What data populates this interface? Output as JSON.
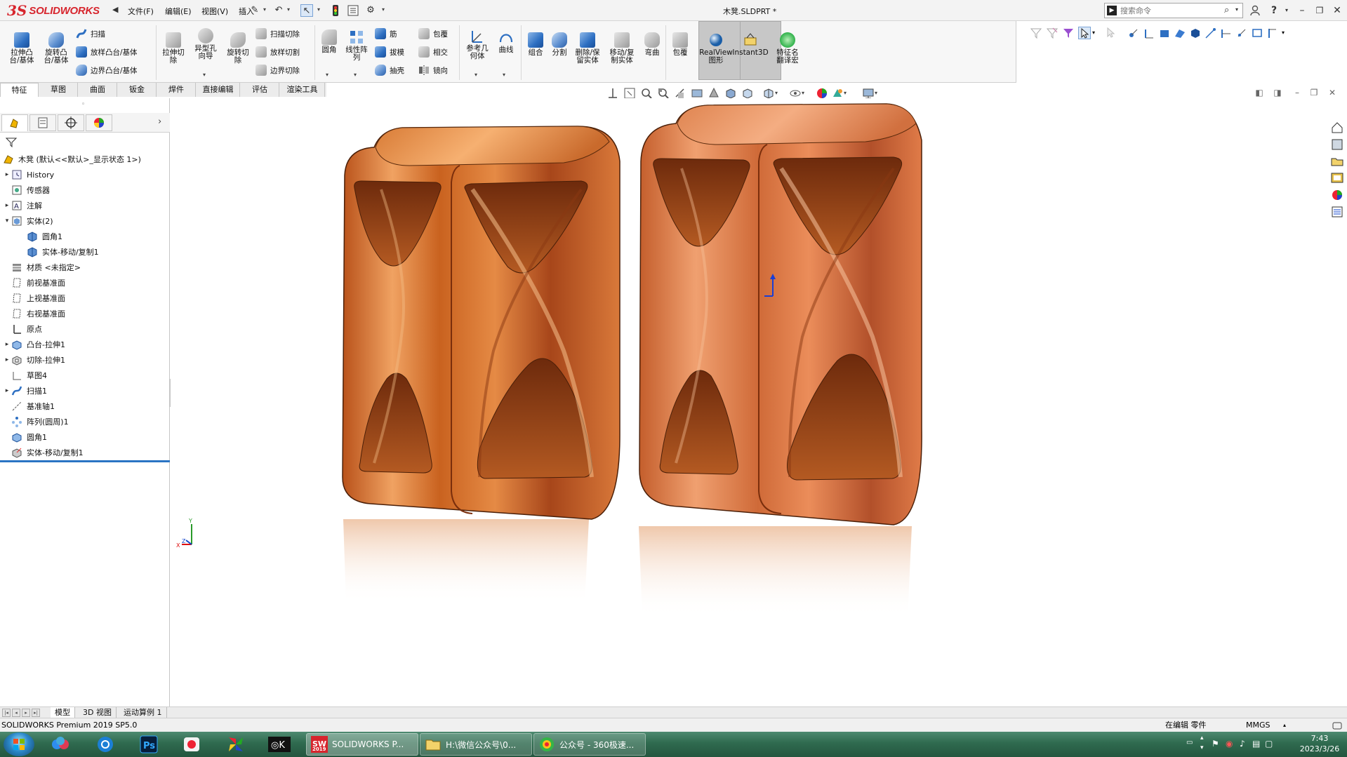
{
  "app": {
    "brand_ds": "3S",
    "brand_name": "SOLIDWORKS",
    "document_title": "木凳.SLDPRT *",
    "menus": [
      "文件(F)",
      "编辑(E)",
      "视图(V)",
      "插入"
    ],
    "search_placeholder": "搜索命令"
  },
  "ribbon": {
    "big_buttons": [
      {
        "name": "extruded-boss-button",
        "label": "拉伸凸\n台/基体"
      },
      {
        "name": "revolved-boss-button",
        "label": "旋转凸\n台/基体"
      },
      {
        "name": "extruded-cut-button",
        "label": "拉伸切\n除"
      },
      {
        "name": "hole-wizard-button",
        "label": "异型孔\n向导"
      },
      {
        "name": "revolved-cut-button",
        "label": "旋转切\n除"
      },
      {
        "name": "fillet-button",
        "label": "圆角"
      },
      {
        "name": "linear-pattern-button",
        "label": "线性阵\n列"
      },
      {
        "name": "reference-geometry-button",
        "label": "参考几\n何体"
      },
      {
        "name": "curves-button",
        "label": "曲线"
      },
      {
        "name": "combine-button",
        "label": "组合"
      },
      {
        "name": "split-button",
        "label": "分割"
      },
      {
        "name": "delete-keep-body-button",
        "label": "删除/保\n留实体"
      },
      {
        "name": "move-copy-body-button",
        "label": "移动/复\n制实体"
      },
      {
        "name": "flex-button",
        "label": "弯曲"
      },
      {
        "name": "wrap-big-button",
        "label": "包覆"
      },
      {
        "name": "realview-button",
        "label": "RealView\n图形"
      },
      {
        "name": "instant3d-button",
        "label": "Instant3D"
      },
      {
        "name": "feature-translate-button",
        "label": "特征名\n翻译宏"
      }
    ],
    "small_buttons": {
      "sweep": "扫描",
      "loft_boss": "放样凸台/基体",
      "boundary_boss": "边界凸台/基体",
      "swept_cut": "扫描切除",
      "lofted_cut": "放样切割",
      "boundary_cut": "边界切除",
      "rib": "筋",
      "draft": "拔模",
      "shell": "抽壳",
      "wrap": "包覆",
      "intersect": "相交",
      "mirror": "镜向"
    }
  },
  "command_tabs": [
    "特征",
    "草图",
    "曲面",
    "钣金",
    "焊件",
    "直接编辑",
    "评估",
    "渲染工具"
  ],
  "feature_tree": [
    {
      "label": "木凳 (默认<<默认>_显示状态 1>)",
      "icon": "part-icon",
      "indent": 0,
      "expander": ""
    },
    {
      "label": "History",
      "icon": "history-icon",
      "indent": 1,
      "expander": "▸"
    },
    {
      "label": "传感器",
      "icon": "sensor-icon",
      "indent": 1,
      "expander": ""
    },
    {
      "label": "注解",
      "icon": "annotation-icon",
      "indent": 1,
      "expander": "▸"
    },
    {
      "label": "实体(2)",
      "icon": "solid-bodies-icon",
      "indent": 1,
      "expander": "▾"
    },
    {
      "label": "圆角1",
      "icon": "body-icon",
      "indent": 2,
      "expander": ""
    },
    {
      "label": "实体-移动/复制1",
      "icon": "body-icon",
      "indent": 2,
      "expander": ""
    },
    {
      "label": "材质 <未指定>",
      "icon": "material-icon",
      "indent": 1,
      "expander": ""
    },
    {
      "label": "前视基准面",
      "icon": "plane-icon",
      "indent": 1,
      "expander": ""
    },
    {
      "label": "上视基准面",
      "icon": "plane-icon",
      "indent": 1,
      "expander": ""
    },
    {
      "label": "右视基准面",
      "icon": "plane-icon",
      "indent": 1,
      "expander": ""
    },
    {
      "label": "原点",
      "icon": "origin-icon",
      "indent": 1,
      "expander": ""
    },
    {
      "label": "凸台-拉伸1",
      "icon": "extrude-icon",
      "indent": 1,
      "expander": "▸"
    },
    {
      "label": "切除-拉伸1",
      "icon": "cut-icon",
      "indent": 1,
      "expander": "▸"
    },
    {
      "label": "草图4",
      "icon": "sketch-icon",
      "indent": 1,
      "expander": ""
    },
    {
      "label": "扫描1",
      "icon": "sweep-icon",
      "indent": 1,
      "expander": "▸"
    },
    {
      "label": "基准轴1",
      "icon": "axis-icon",
      "indent": 1,
      "expander": ""
    },
    {
      "label": "阵列(圆周)1",
      "icon": "circular-pattern-icon",
      "indent": 1,
      "expander": ""
    },
    {
      "label": "圆角1",
      "icon": "fillet-icon",
      "indent": 1,
      "expander": ""
    },
    {
      "label": "实体-移动/复制1",
      "icon": "move-body-icon",
      "indent": 1,
      "expander": ""
    }
  ],
  "bottom_tabs": [
    "模型",
    "3D 视图",
    "运动算例 1"
  ],
  "status": {
    "product": "SOLIDWORKS Premium 2019 SP5.0",
    "editing": "在编辑 零件",
    "units": "MMGS"
  },
  "taskbar": {
    "tasks": [
      {
        "label": "SOLIDWORKS P...",
        "badge": "2019"
      },
      {
        "label": "H:\\微信公众号\\0..."
      },
      {
        "label": "公众号 - 360极速..."
      }
    ],
    "time": "7:43",
    "date": "2023/3/26"
  },
  "colors": {
    "wood_light": "#f2a35a",
    "wood_mid": "#d26a22",
    "wood_dark": "#7a2e0c",
    "brand_red": "#d7252d"
  }
}
